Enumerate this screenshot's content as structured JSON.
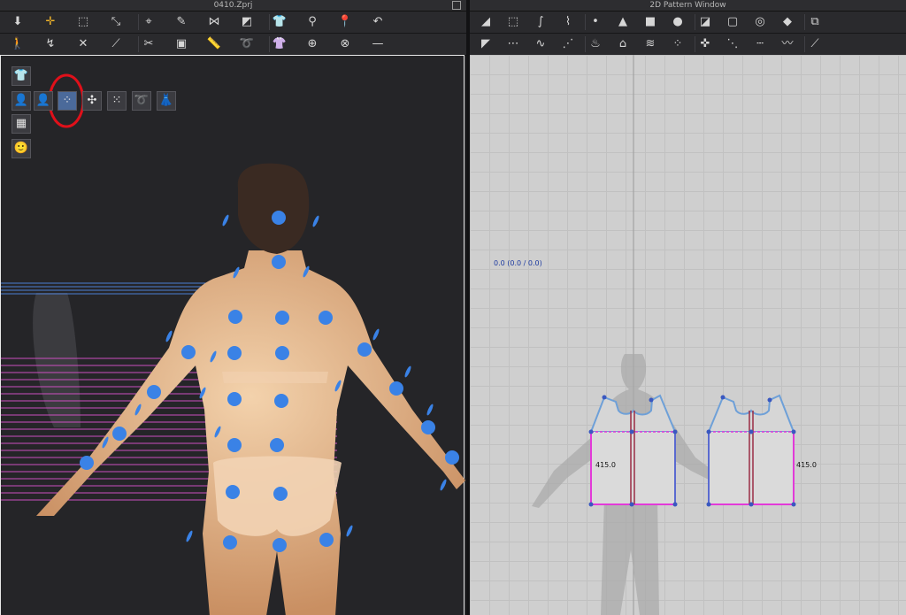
{
  "left_window": {
    "title": "0410.Zprj",
    "toolbar_row1": [
      "arrow-down-icon",
      "move-cursor-icon",
      "select-box-icon",
      "transform-icon",
      "edit-point-icon",
      "pen-icon",
      "sewing-icon",
      "fold-icon",
      "garment-icon",
      "tack-icon",
      "pin-icon",
      "avatar-arrange-icon"
    ],
    "toolbar_row2": [
      "walk-pose-icon",
      "fold-arrange-icon",
      "cross-tool-icon",
      "line-arrange-icon",
      "cut-tool-icon",
      "garment-paste-icon",
      "measure-icon",
      "tape-icon",
      "shirt-fit-icon",
      "button-icon",
      "buttonhole-icon",
      "line-tool-icon"
    ]
  },
  "right_window": {
    "title": "2D Pattern Window",
    "toolbar_row1": [
      "edit-pattern-icon",
      "transform-pattern-icon",
      "edit-curve-icon",
      "curve-point-icon",
      "add-point-icon",
      "polygon-icon",
      "rectangle-icon",
      "ellipse-icon",
      "internal-polygon-icon",
      "internal-rect-icon",
      "internal-circle-icon",
      "dart-icon",
      "trace-icon"
    ],
    "toolbar_row2": [
      "select-mesh-icon",
      "segment-sewing-icon",
      "free-sewing-icon",
      "edit-sewing-icon",
      "steam-icon",
      "fold-tool-icon",
      "shirring-icon",
      "arrangement-icon",
      "pin-tool-icon",
      "topstitch-icon",
      "seam-line-icon",
      "zigzag-icon",
      "measure-line-icon"
    ],
    "coordinate_readout": "0.0 (0.0 / 0.0)",
    "measure_left": "415.0",
    "measure_right": "415.0"
  },
  "viewport_buttons": [
    {
      "name": "show-garment-icon",
      "glyph": "👕"
    },
    {
      "name": "show-avatar-icon",
      "glyph": "👤"
    },
    {
      "name": "show-avatar-skin-icon",
      "glyph": "👤"
    },
    {
      "name": "show-arrangement-points-icon",
      "glyph": "⁘"
    },
    {
      "name": "show-joints-icon",
      "glyph": "✣"
    },
    {
      "name": "show-xray-icon",
      "glyph": "⁙"
    },
    {
      "name": "show-measure-icon",
      "glyph": "➰"
    },
    {
      "name": "show-fit-map-icon",
      "glyph": "👗"
    },
    {
      "name": "show-texture-icon",
      "glyph": "▦"
    },
    {
      "name": "show-avatar-face-icon",
      "glyph": "🙂"
    }
  ],
  "colors": {
    "arrangement_point": "#3a82e6",
    "highlight_circle": "#e0101a",
    "pattern_outline": "#e23ad8",
    "internal_line": "#9a2c44",
    "accent_active": "#f0b42a",
    "coordinate_text": "#1c3aa0"
  }
}
